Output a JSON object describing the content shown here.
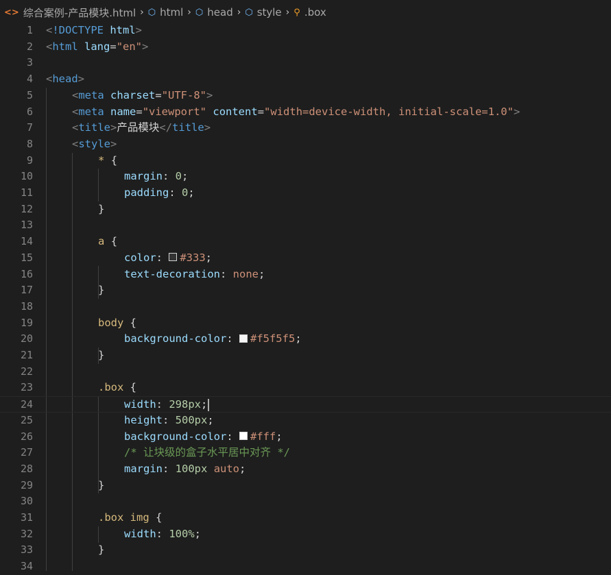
{
  "breadcrumb": {
    "file": "综合案例-产品模块.html",
    "items": [
      "html",
      "head",
      "style",
      ".box"
    ]
  },
  "colors": {
    "background": "#1e1e1e",
    "swatch_333": "#333333",
    "swatch_f5f5f5": "#f5f5f5",
    "swatch_fff": "#ffffff"
  },
  "lines": [
    {
      "n": "1",
      "indent": 0,
      "tokens": [
        [
          "t-punct",
          "<"
        ],
        [
          "t-tag",
          "!DOCTYPE"
        ],
        [
          "t-text",
          " "
        ],
        [
          "t-attr",
          "html"
        ],
        [
          "t-punct",
          ">"
        ]
      ]
    },
    {
      "n": "2",
      "indent": 0,
      "tokens": [
        [
          "t-punct",
          "<"
        ],
        [
          "t-tag",
          "html"
        ],
        [
          "t-text",
          " "
        ],
        [
          "t-attr",
          "lang"
        ],
        [
          "t-text",
          "="
        ],
        [
          "t-str",
          "\"en\""
        ],
        [
          "t-punct",
          ">"
        ]
      ]
    },
    {
      "n": "3",
      "indent": 0,
      "tokens": []
    },
    {
      "n": "4",
      "indent": 0,
      "tokens": [
        [
          "t-punct",
          "<"
        ],
        [
          "t-tag",
          "head"
        ],
        [
          "t-punct",
          ">"
        ]
      ]
    },
    {
      "n": "5",
      "indent": 1,
      "tokens": [
        [
          "t-punct",
          "<"
        ],
        [
          "t-tag",
          "meta"
        ],
        [
          "t-text",
          " "
        ],
        [
          "t-attr",
          "charset"
        ],
        [
          "t-text",
          "="
        ],
        [
          "t-str",
          "\"UTF-8\""
        ],
        [
          "t-punct",
          ">"
        ]
      ]
    },
    {
      "n": "6",
      "indent": 1,
      "tokens": [
        [
          "t-punct",
          "<"
        ],
        [
          "t-tag",
          "meta"
        ],
        [
          "t-text",
          " "
        ],
        [
          "t-attr",
          "name"
        ],
        [
          "t-text",
          "="
        ],
        [
          "t-str",
          "\"viewport\""
        ],
        [
          "t-text",
          " "
        ],
        [
          "t-attr",
          "content"
        ],
        [
          "t-text",
          "="
        ],
        [
          "t-str",
          "\"width=device-width, initial-scale=1.0\""
        ],
        [
          "t-punct",
          ">"
        ]
      ]
    },
    {
      "n": "7",
      "indent": 1,
      "tokens": [
        [
          "t-punct",
          "<"
        ],
        [
          "t-tag",
          "title"
        ],
        [
          "t-punct",
          ">"
        ],
        [
          "t-text",
          "产品模块"
        ],
        [
          "t-punct",
          "</"
        ],
        [
          "t-tag",
          "title"
        ],
        [
          "t-punct",
          ">"
        ]
      ]
    },
    {
      "n": "8",
      "indent": 1,
      "tokens": [
        [
          "t-punct",
          "<"
        ],
        [
          "t-tag",
          "style"
        ],
        [
          "t-punct",
          ">"
        ]
      ]
    },
    {
      "n": "9",
      "indent": 2,
      "tokens": [
        [
          "t-sel",
          "*"
        ],
        [
          "t-text",
          " "
        ],
        [
          "t-brace",
          "{"
        ]
      ]
    },
    {
      "n": "10",
      "indent": 3,
      "tokens": [
        [
          "t-prop",
          "margin"
        ],
        [
          "t-text",
          ": "
        ],
        [
          "t-num",
          "0"
        ],
        [
          "t-text",
          ";"
        ]
      ]
    },
    {
      "n": "11",
      "indent": 3,
      "tokens": [
        [
          "t-prop",
          "padding"
        ],
        [
          "t-text",
          ": "
        ],
        [
          "t-num",
          "0"
        ],
        [
          "t-text",
          ";"
        ]
      ]
    },
    {
      "n": "12",
      "indent": 2,
      "tokens": [
        [
          "t-brace",
          "}"
        ]
      ]
    },
    {
      "n": "13",
      "indent": 0,
      "tokens": []
    },
    {
      "n": "14",
      "indent": 2,
      "tokens": [
        [
          "t-sel",
          "a"
        ],
        [
          "t-text",
          " "
        ],
        [
          "t-brace",
          "{"
        ]
      ]
    },
    {
      "n": "15",
      "indent": 3,
      "tokens": [
        [
          "t-prop",
          "color"
        ],
        [
          "t-text",
          ": "
        ],
        [
          "swatch",
          "#333333"
        ],
        [
          "t-val",
          "#333"
        ],
        [
          "t-text",
          ";"
        ]
      ]
    },
    {
      "n": "16",
      "indent": 3,
      "tokens": [
        [
          "t-prop",
          "text-decoration"
        ],
        [
          "t-text",
          ": "
        ],
        [
          "t-val",
          "none"
        ],
        [
          "t-text",
          ";"
        ]
      ]
    },
    {
      "n": "17",
      "indent": 2,
      "tokens": [
        [
          "t-brace",
          "}"
        ]
      ]
    },
    {
      "n": "18",
      "indent": 0,
      "tokens": []
    },
    {
      "n": "19",
      "indent": 2,
      "tokens": [
        [
          "t-sel",
          "body"
        ],
        [
          "t-text",
          " "
        ],
        [
          "t-brace",
          "{"
        ]
      ]
    },
    {
      "n": "20",
      "indent": 3,
      "tokens": [
        [
          "t-prop",
          "background-color"
        ],
        [
          "t-text",
          ": "
        ],
        [
          "swatch",
          "#f5f5f5"
        ],
        [
          "t-val",
          "#f5f5f5"
        ],
        [
          "t-text",
          ";"
        ]
      ]
    },
    {
      "n": "21",
      "indent": 2,
      "tokens": [
        [
          "t-brace",
          "}"
        ]
      ]
    },
    {
      "n": "22",
      "indent": 0,
      "tokens": []
    },
    {
      "n": "23",
      "indent": 2,
      "tokens": [
        [
          "t-sel",
          ".box"
        ],
        [
          "t-text",
          " "
        ],
        [
          "t-brace",
          "{"
        ]
      ]
    },
    {
      "n": "24",
      "indent": 3,
      "current": true,
      "tokens": [
        [
          "t-prop",
          "width"
        ],
        [
          "t-text",
          ": "
        ],
        [
          "t-num",
          "298px"
        ],
        [
          "t-text",
          ";"
        ]
      ]
    },
    {
      "n": "25",
      "indent": 3,
      "tokens": [
        [
          "t-prop",
          "height"
        ],
        [
          "t-text",
          ": "
        ],
        [
          "t-num",
          "500px"
        ],
        [
          "t-text",
          ";"
        ]
      ]
    },
    {
      "n": "26",
      "indent": 3,
      "tokens": [
        [
          "t-prop",
          "background-color"
        ],
        [
          "t-text",
          ": "
        ],
        [
          "swatch",
          "#ffffff"
        ],
        [
          "t-val",
          "#fff"
        ],
        [
          "t-text",
          ";"
        ]
      ]
    },
    {
      "n": "27",
      "indent": 3,
      "tokens": [
        [
          "t-comment",
          "/* 让块级的盒子水平居中对齐 */"
        ]
      ]
    },
    {
      "n": "28",
      "indent": 3,
      "tokens": [
        [
          "t-prop",
          "margin"
        ],
        [
          "t-text",
          ": "
        ],
        [
          "t-num",
          "100px"
        ],
        [
          "t-text",
          " "
        ],
        [
          "t-val",
          "auto"
        ],
        [
          "t-text",
          ";"
        ]
      ]
    },
    {
      "n": "29",
      "indent": 2,
      "tokens": [
        [
          "t-brace",
          "}"
        ]
      ]
    },
    {
      "n": "30",
      "indent": 0,
      "tokens": []
    },
    {
      "n": "31",
      "indent": 2,
      "tokens": [
        [
          "t-sel",
          ".box img"
        ],
        [
          "t-text",
          " "
        ],
        [
          "t-brace",
          "{"
        ]
      ]
    },
    {
      "n": "32",
      "indent": 3,
      "tokens": [
        [
          "t-prop",
          "width"
        ],
        [
          "t-text",
          ": "
        ],
        [
          "t-num",
          "100%"
        ],
        [
          "t-text",
          ";"
        ]
      ]
    },
    {
      "n": "33",
      "indent": 2,
      "tokens": [
        [
          "t-brace",
          "}"
        ]
      ]
    },
    {
      "n": "34",
      "indent": 0,
      "tokens": []
    }
  ]
}
